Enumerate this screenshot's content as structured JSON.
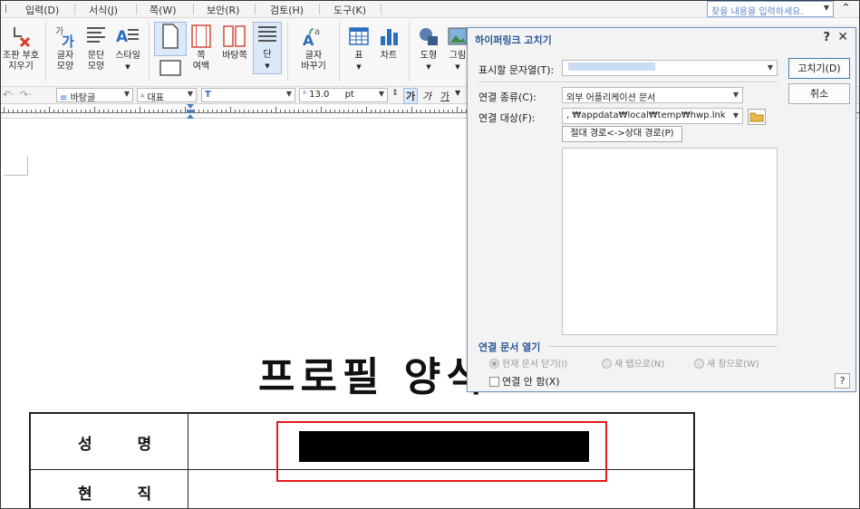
{
  "menu": {
    "items": [
      "입력(D)",
      "서식(J)",
      "쪽(W)",
      "보안(R)",
      "검토(H)",
      "도구(K)"
    ],
    "search_placeholder": "찾을 내용을 입력하세요."
  },
  "ribbon": {
    "remove_marks": "조판 부호\n지우기",
    "char_shape": "글자\n모양",
    "para_shape": "문단\n모양",
    "style": "스타일",
    "page_margin": "쪽\n여백",
    "background": "바탕쪽",
    "columns": "단",
    "char_change": "글자\n바꾸기",
    "table": "표",
    "chart": "차트",
    "shape": "도형",
    "picture": "그림"
  },
  "format_bar": {
    "style_name": "바탕글",
    "lang": "대표",
    "font_prefix": "T",
    "font_size": "13.0",
    "unit": "pt",
    "bold": "가",
    "italic": "가",
    "underline": "가"
  },
  "document": {
    "title": "프로필 양식",
    "rows": [
      {
        "label": "성 명"
      },
      {
        "label": "현 직"
      }
    ]
  },
  "dialog": {
    "title": "하이퍼링크 고치기",
    "help": "?",
    "close": "✕",
    "display_text_label": "표시할 문자열(T):",
    "link_type_label": "연결 종류(C):",
    "link_type_value": "외부 어플리케이션 문서",
    "link_target_label": "연결 대상(F):",
    "link_target_value": ", ₩appdata₩local₩temp₩hwp.lnk",
    "path_toggle": "절대 경로<->상대 경로(P)",
    "ok_button": "고치기(D)",
    "cancel_button": "취소",
    "open_group": "연결 문서 열기",
    "radio_current": "현재 문서 닫기(I)",
    "radio_new_tab": "새 탭으로(N)",
    "radio_new_window": "새 창으로(W)",
    "no_link": "연결 안 함(X)",
    "help_small": "?"
  }
}
